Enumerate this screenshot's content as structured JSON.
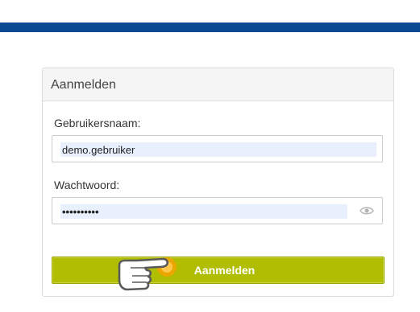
{
  "header": {
    "bar_color": "#0b4a93"
  },
  "login_panel": {
    "title": "Aanmelden",
    "username": {
      "label": "Gebruikersnaam:",
      "value": "demo.gebruiker"
    },
    "password": {
      "label": "Wachtwoord:",
      "value": "••••••••••",
      "toggle_icon": "eye-icon"
    },
    "submit_label": "Aanmelden",
    "accent_color": "#b1bd00"
  },
  "cursor": {
    "icon": "hand-pointer-icon",
    "highlight_color": "#f5a300"
  }
}
